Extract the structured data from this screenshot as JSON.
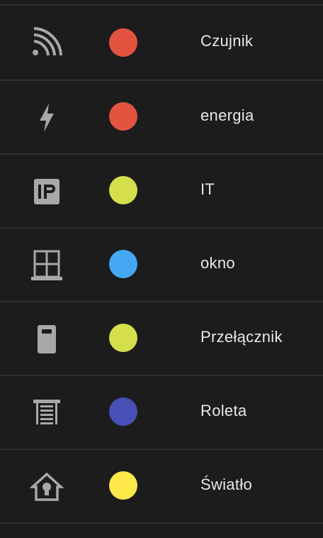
{
  "labels": [
    {
      "name": "Czujnik",
      "icon": "wifi-sensor-icon",
      "color": "#e35440"
    },
    {
      "name": "energia",
      "icon": "lightning-bolt-icon",
      "color": "#e35440"
    },
    {
      "name": "IT",
      "icon": "ip-icon",
      "color": "#d4df4a"
    },
    {
      "name": "okno",
      "icon": "window-icon",
      "color": "#45a8f2"
    },
    {
      "name": "Przełącznik",
      "icon": "switch-icon",
      "color": "#d4df4a"
    },
    {
      "name": "Roleta",
      "icon": "roller-shutter-icon",
      "color": "#4650b6"
    },
    {
      "name": "Światło",
      "icon": "home-lightbulb-icon",
      "color": "#ffe84a"
    }
  ]
}
